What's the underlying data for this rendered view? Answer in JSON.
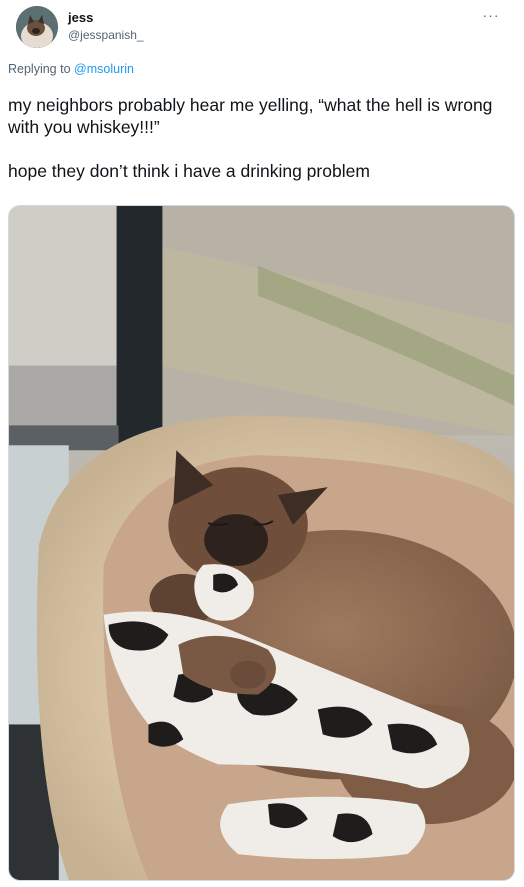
{
  "author": {
    "display_name": "jess",
    "handle": "@jesspanish_",
    "avatar_icon": "profile-photo"
  },
  "menu": {
    "more_icon": "more-dots-icon",
    "more_label": "···"
  },
  "reply": {
    "prefix": "Replying to",
    "mention": "@msolurin"
  },
  "tweet": {
    "text_line1": "my neighbors probably hear me yelling, “what the hell is wrong with you whiskey!!!”",
    "text_line2": "hope they don’t think i have a drinking problem"
  },
  "colors": {
    "text": "#0f1419",
    "secondary": "#536471",
    "link": "#1d9bf0"
  }
}
